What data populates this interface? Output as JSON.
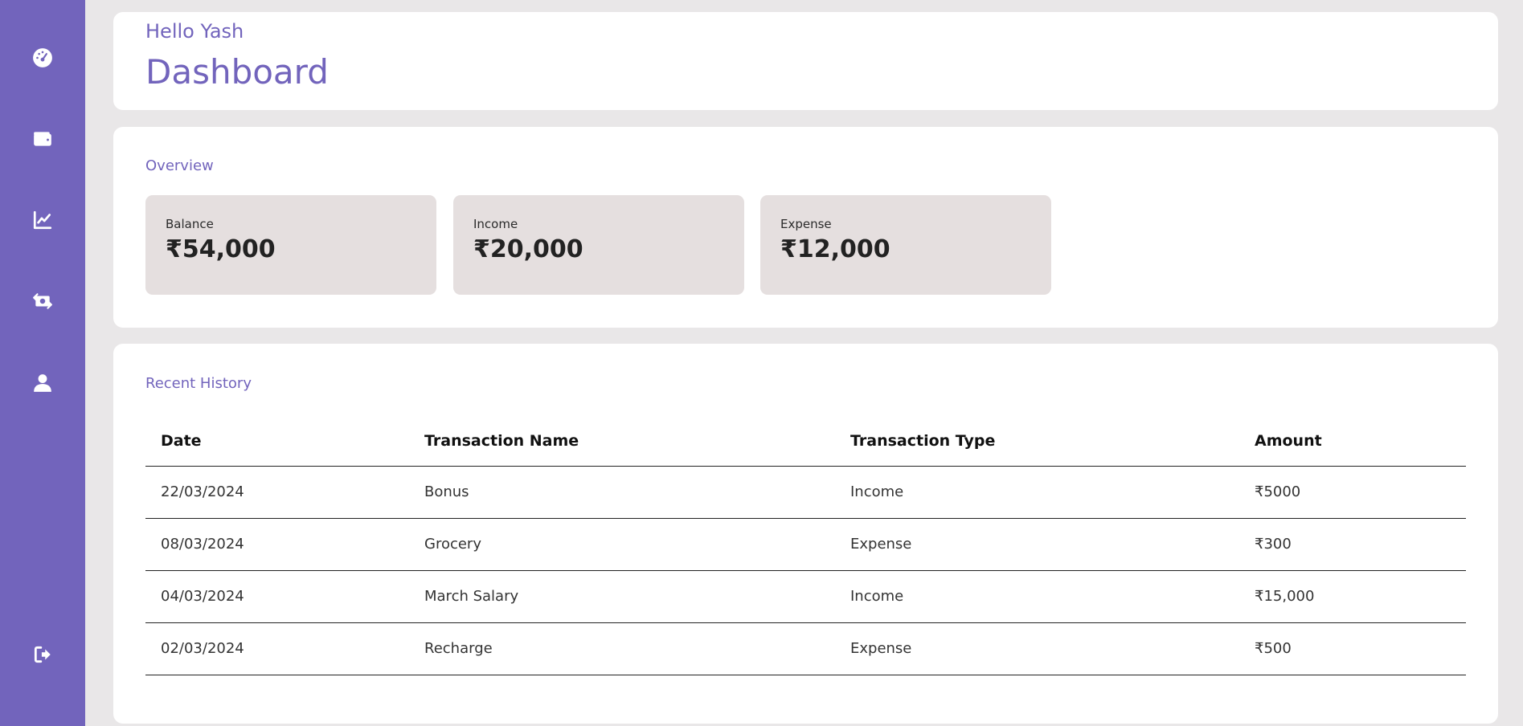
{
  "sidebar": {
    "items": [
      {
        "icon": "gauge-icon"
      },
      {
        "icon": "wallet-icon"
      },
      {
        "icon": "chart-line-icon"
      },
      {
        "icon": "money-exchange-icon"
      },
      {
        "icon": "user-icon"
      }
    ],
    "logout_icon": "logout-icon",
    "bg_color": "#7264bc"
  },
  "header": {
    "greeting": "Hello Yash",
    "title": "Dashboard"
  },
  "overview": {
    "title": "Overview",
    "stats": [
      {
        "label": "Balance",
        "value": "₹54,000"
      },
      {
        "label": "Income",
        "value": "₹20,000"
      },
      {
        "label": "Expense",
        "value": "₹12,000"
      }
    ]
  },
  "history": {
    "title": "Recent History",
    "columns": [
      "Date",
      "Transaction Name",
      "Transaction Type",
      "Amount"
    ],
    "rows": [
      [
        "22/03/2024",
        "Bonus",
        "Income",
        "₹5000"
      ],
      [
        "08/03/2024",
        "Grocery",
        "Expense",
        "₹300"
      ],
      [
        "04/03/2024",
        "March Salary",
        "Income",
        "₹15,000"
      ],
      [
        "02/03/2024",
        "Recharge",
        "Expense",
        "₹500"
      ]
    ]
  },
  "colors": {
    "accent": "#7264bc",
    "background": "#e9e7e8",
    "stat_card": "#e5dfdf"
  }
}
